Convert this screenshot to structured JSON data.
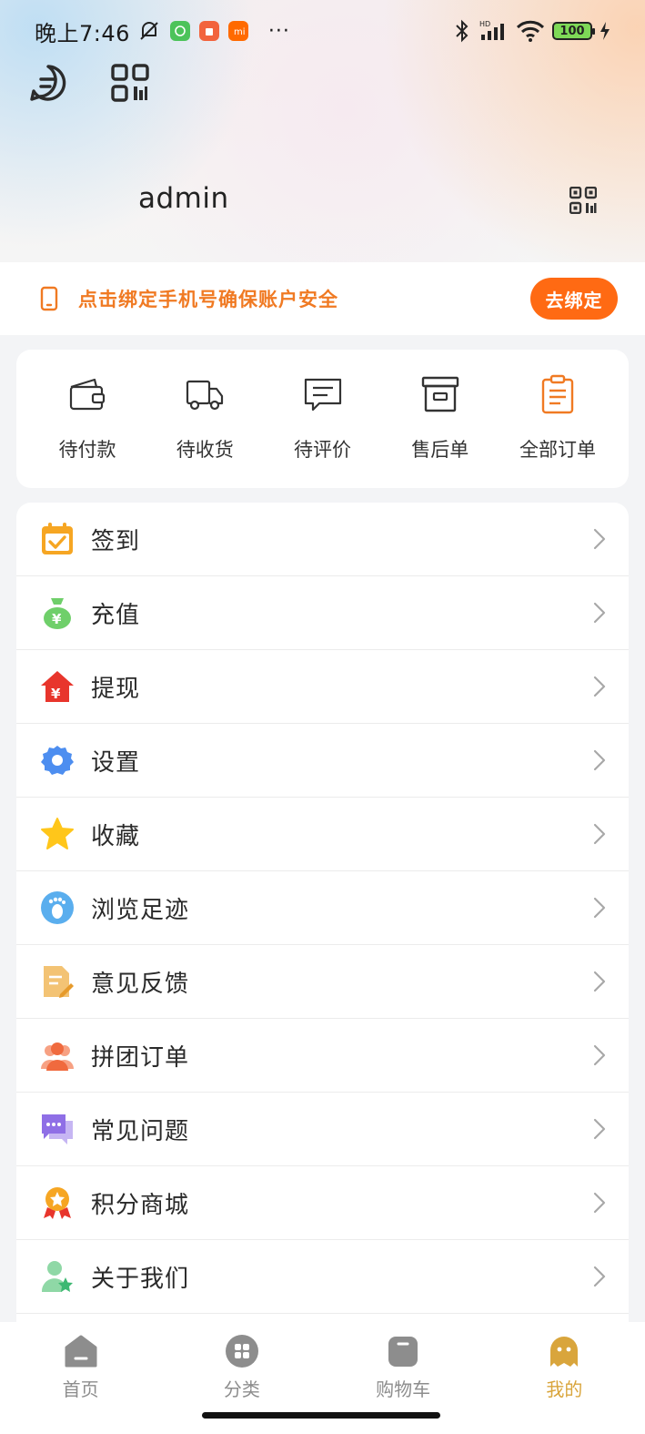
{
  "status_bar": {
    "time": "晚上7:46",
    "battery": "100",
    "more": "···"
  },
  "profile": {
    "username": "admin"
  },
  "bind_phone": {
    "text": "点击绑定手机号确保账户安全",
    "button": "去绑定",
    "accent": "#f07a23"
  },
  "orders": [
    {
      "label": "待付款",
      "icon": "wallet-icon"
    },
    {
      "label": "待收货",
      "icon": "truck-icon"
    },
    {
      "label": "待评价",
      "icon": "comment-icon"
    },
    {
      "label": "售后单",
      "icon": "archive-icon"
    },
    {
      "label": "全部订单",
      "icon": "clipboard-icon"
    }
  ],
  "menu": [
    {
      "label": "签到",
      "icon": "calendar-check-icon"
    },
    {
      "label": "充值",
      "icon": "money-bag-icon"
    },
    {
      "label": "提现",
      "icon": "house-yen-icon"
    },
    {
      "label": "设置",
      "icon": "gear-icon"
    },
    {
      "label": "收藏",
      "icon": "star-icon"
    },
    {
      "label": "浏览足迹",
      "icon": "footprint-icon"
    },
    {
      "label": "意见反馈",
      "icon": "feedback-doc-icon"
    },
    {
      "label": "拼团订单",
      "icon": "group-icon"
    },
    {
      "label": "常见问题",
      "icon": "chat-bubbles-icon"
    },
    {
      "label": "积分商城",
      "icon": "medal-icon"
    },
    {
      "label": "关于我们",
      "icon": "user-star-icon"
    }
  ],
  "tabs": [
    {
      "label": "首页",
      "icon": "home-icon",
      "active": false
    },
    {
      "label": "分类",
      "icon": "category-icon",
      "active": false
    },
    {
      "label": "购物车",
      "icon": "cart-icon",
      "active": false
    },
    {
      "label": "我的",
      "icon": "profile-icon",
      "active": true
    }
  ],
  "colors": {
    "tab_active": "#d9a53c",
    "tab_inactive": "#8d8d8d",
    "bind_button": "#ff6a13"
  }
}
